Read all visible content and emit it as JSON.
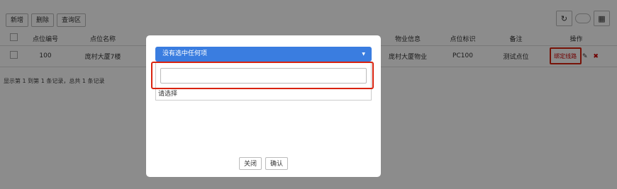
{
  "toolbar": {
    "add": "新增",
    "delete": "删除",
    "query": "查询区"
  },
  "tools": {
    "refresh_icon": "refresh-icon",
    "columns_icon": "grid-icon"
  },
  "table": {
    "headers": {
      "code": "点位编号",
      "name": "点位名称",
      "property": "物业信息",
      "identifier": "点位标识",
      "remark": "备注",
      "operation": "操作"
    },
    "rows": [
      {
        "code": "100",
        "name": "庞村大厦7楼",
        "property": "庞村大厦物业",
        "identifier": "PC100",
        "remark": "测试点位",
        "bind": "绑定线路"
      }
    ]
  },
  "pager": {
    "text": "显示第 1 到第 1 条记录，总共 1 条记录"
  },
  "modal": {
    "select_text": "没有选中任何项",
    "search_value": "",
    "option_text": "请选择",
    "close": "关闭",
    "confirm": "确认"
  },
  "colors": {
    "select_bg": "#3a7de0",
    "highlight": "#d9230f",
    "danger": "#cc0000"
  }
}
